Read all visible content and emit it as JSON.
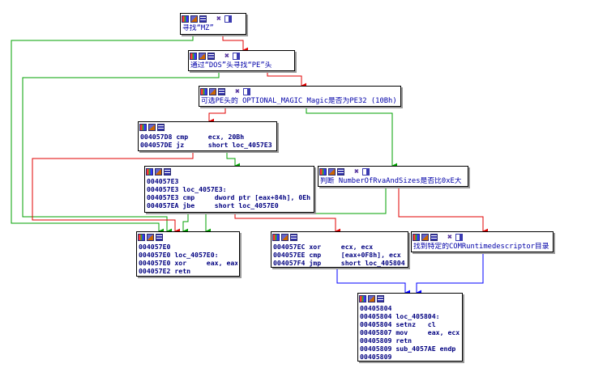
{
  "colors": {
    "edge_true": "#00a000",
    "edge_false": "#e00000",
    "edge_uncond": "#0000ff"
  },
  "nodes": {
    "n_mz": {
      "header": "full",
      "lines": [
        "寻找“MZ”"
      ]
    },
    "n_pe": {
      "header": "full",
      "lines": [
        "通过“DOS”头寻找“PE”头"
      ]
    },
    "n_opt": {
      "header": "full",
      "lines": [
        "可选PE头的 OPTIONAL_MAGIC Magic是否为PE32 (10Bh)"
      ]
    },
    "n_cmp": {
      "header": "short",
      "lines": [
        "004057D8 cmp     ecx, 20Bh",
        "004057DE jz      short loc_4057E3"
      ]
    },
    "n_e3": {
      "header": "short",
      "lines": [
        "004057E3",
        "004057E3 loc_4057E3:",
        "004057E3 cmp     dword ptr [eax+84h], 0Eh",
        "004057EA jbe     short loc_4057E0"
      ]
    },
    "n_num": {
      "header": "full",
      "lines": [
        "判断 NumberOfRvaAndSizes是否比0xE大"
      ]
    },
    "n_e0": {
      "header": "short",
      "lines": [
        "004057E0",
        "004057E0 loc_4057E0:",
        "004057E0 xor     eax, eax",
        "004057E2 retn"
      ]
    },
    "n_ec": {
      "header": "short",
      "lines": [
        "004057EC xor     ecx, ecx",
        "004057EE cmp     [eax+0F8h], ecx",
        "004057F4 jmp     short loc_405804"
      ]
    },
    "n_com": {
      "header": "full",
      "lines": [
        "找到特定的COMRuntimedescriptor目录"
      ]
    },
    "n_804": {
      "header": "short",
      "lines": [
        "00405804",
        "00405804 loc_405804:",
        "00405804 setnz   cl",
        "00405807 mov     eax, ecx",
        "00405809 retn",
        "00405809 sub_4057AE endp",
        "00405809"
      ]
    }
  },
  "icons": {
    "header_full": [
      "graph-icon",
      "image-icon",
      "list-icon",
      "group-icon",
      "color-icon"
    ],
    "header_short": [
      "graph-icon",
      "image-icon",
      "list-icon"
    ]
  }
}
